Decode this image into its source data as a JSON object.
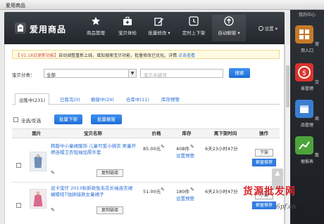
{
  "window": {
    "title": "爱用商品"
  },
  "app": {
    "brand": "爱用商品",
    "nav": [
      {
        "label": "商品管理",
        "icon": "star-icon"
      },
      {
        "label": "宝贝体检",
        "icon": "medical-bag-icon"
      },
      {
        "label": "批量修改",
        "icon": "edit-icon"
      },
      {
        "label": "定时上下架",
        "icon": "clock-icon"
      },
      {
        "label": "自动橱窗",
        "icon": "upload-icon"
      }
    ],
    "settings": "设置"
  },
  "notice": {
    "date_tag": "【 01.18日更新功能】",
    "text": "自动调整重新上线，增加搜索宝贝功能，批量修改已优化。详情",
    "link": "点击查看"
  },
  "search": {
    "category_label": "宝贝分类：",
    "category_value": "全部",
    "keyword_placeholder": "宝贝关键词",
    "search_button": "搜索"
  },
  "tabs": [
    {
      "label": "出售中(231)"
    },
    {
      "label": "已售完(0)"
    },
    {
      "label": "橱窗中(29)"
    },
    {
      "label": "仓库中(11)"
    },
    {
      "label": "库存预警"
    }
  ],
  "bulk": {
    "select_all": "全选/反选",
    "batch_list": "批量下架",
    "batch_window": "批量橱窗"
  },
  "table": {
    "headers": [
      "图片",
      "宝贝名称",
      "价格",
      "库存",
      "离下架时间",
      "操作"
    ],
    "rows": [
      {
        "title": "韩版中小童裙服饰 儿童可爱小佛衣 男童开襟连帽卫衣短袖加厚外套",
        "copy_link": "复制链接",
        "price": "85.00元",
        "stock": "408件",
        "stock_warn": "设置预警",
        "time_left": "6天23小时47分",
        "op1": "下架",
        "op2": "橱窗推荐"
      },
      {
        "title": "逗卡宝仔 2013秋新款兔毛花长袖连衣裙 蝴蝶结T恤拼接款女童裙子",
        "copy_link": "复制链接",
        "price": "51.00元",
        "stock": "180件",
        "stock_warn": "设置预警",
        "time_left": "6天23小时47分",
        "op1": "下架",
        "op2": "橱窗推荐"
      }
    ]
  },
  "dock": {
    "top": "我的中心",
    "items": [
      {
        "label": "常用入口",
        "color": "#c57a2a"
      },
      {
        "label": "交易管理",
        "color": "#d9322b"
      },
      {
        "label": "商品管理",
        "color": "#3b7ed0"
      },
      {
        "label": "数据报表",
        "color": "#4ea33b"
      }
    ]
  },
  "watermark": {
    "line1": "货源批发网",
    "line2": "6pf.cn"
  }
}
